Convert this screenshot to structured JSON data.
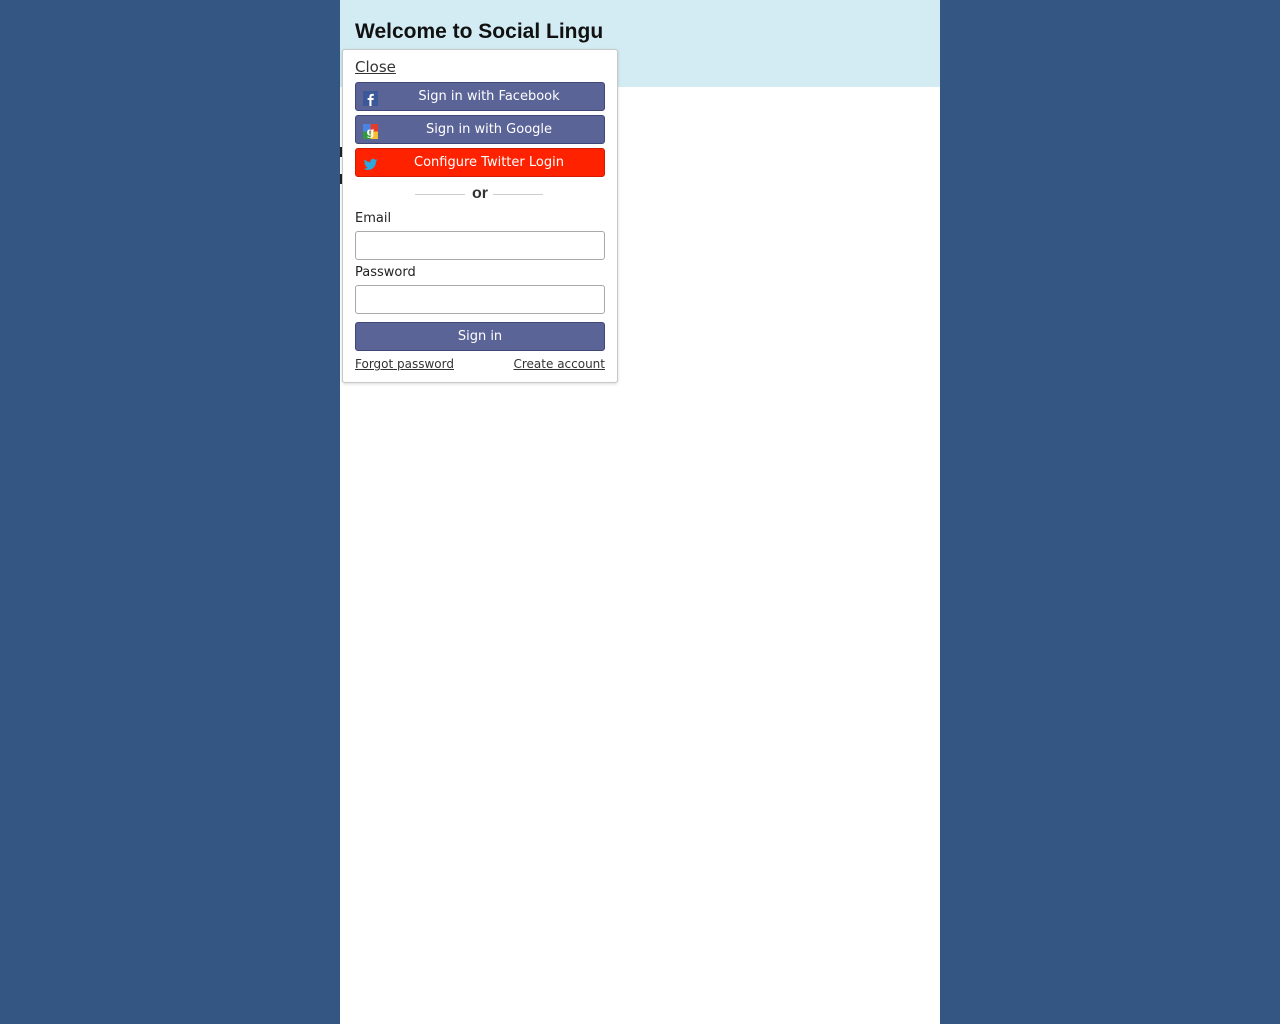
{
  "header": {
    "title": "Welcome to Social Lingu"
  },
  "popup": {
    "close_label": "Close",
    "buttons": {
      "facebook": "Sign in with Facebook",
      "google": "Sign in with Google",
      "twitter": "Configure Twitter Login"
    },
    "divider": "or",
    "email_label": "Email",
    "email_value": "",
    "password_label": "Password",
    "password_value": "",
    "signin_label": "Sign in",
    "forgot_label": "Forgot password",
    "create_label": "Create account"
  },
  "colors": {
    "background": "#335682",
    "header": "#d3ecf3",
    "social_button": "#5b6497",
    "twitter_button": "#ff2200"
  },
  "icons": [
    "facebook-icon",
    "google-icon",
    "twitter-icon"
  ]
}
